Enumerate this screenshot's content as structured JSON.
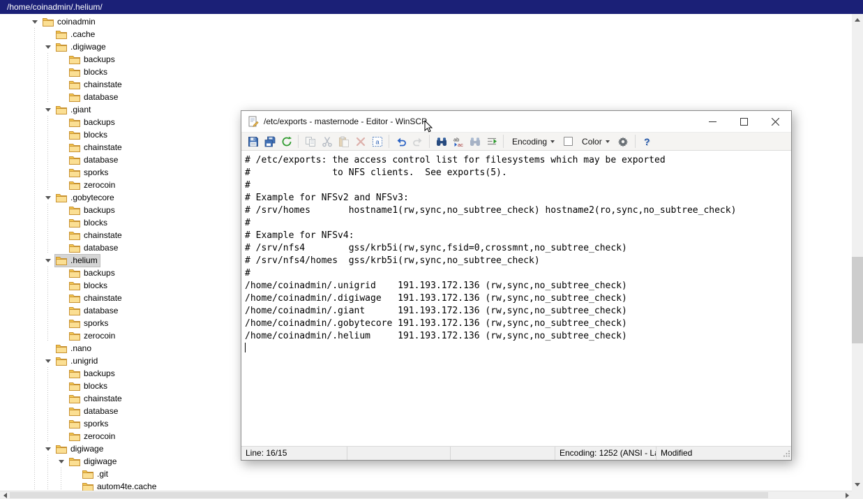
{
  "app": {
    "path": "/home/coinadmin/.helium/"
  },
  "tree": {
    "items": [
      {
        "label": "coinadmin",
        "level": 0,
        "expanded": true
      },
      {
        "label": ".cache",
        "level": 1
      },
      {
        "label": ".digiwage",
        "level": 1,
        "expanded": true
      },
      {
        "label": "backups",
        "level": 2
      },
      {
        "label": "blocks",
        "level": 2
      },
      {
        "label": "chainstate",
        "level": 2
      },
      {
        "label": "database",
        "level": 2
      },
      {
        "label": ".giant",
        "level": 1,
        "expanded": true
      },
      {
        "label": "backups",
        "level": 2
      },
      {
        "label": "blocks",
        "level": 2
      },
      {
        "label": "chainstate",
        "level": 2
      },
      {
        "label": "database",
        "level": 2
      },
      {
        "label": "sporks",
        "level": 2
      },
      {
        "label": "zerocoin",
        "level": 2
      },
      {
        "label": ".gobytecore",
        "level": 1,
        "expanded": true
      },
      {
        "label": "backups",
        "level": 2
      },
      {
        "label": "blocks",
        "level": 2
      },
      {
        "label": "chainstate",
        "level": 2
      },
      {
        "label": "database",
        "level": 2
      },
      {
        "label": ".helium",
        "level": 1,
        "expanded": true,
        "selected": true
      },
      {
        "label": "backups",
        "level": 2
      },
      {
        "label": "blocks",
        "level": 2
      },
      {
        "label": "chainstate",
        "level": 2
      },
      {
        "label": "database",
        "level": 2
      },
      {
        "label": "sporks",
        "level": 2
      },
      {
        "label": "zerocoin",
        "level": 2
      },
      {
        "label": ".nano",
        "level": 1
      },
      {
        "label": ".unigrid",
        "level": 1,
        "expanded": true
      },
      {
        "label": "backups",
        "level": 2
      },
      {
        "label": "blocks",
        "level": 2
      },
      {
        "label": "chainstate",
        "level": 2
      },
      {
        "label": "database",
        "level": 2
      },
      {
        "label": "sporks",
        "level": 2
      },
      {
        "label": "zerocoin",
        "level": 2
      },
      {
        "label": "digiwage",
        "level": 1,
        "expanded": true
      },
      {
        "label": "digiwage",
        "level": 2,
        "expanded": true
      },
      {
        "label": ".git",
        "level": 3
      },
      {
        "label": "autom4te.cache",
        "level": 3
      }
    ]
  },
  "editor": {
    "title": "/etc/exports - masternode - Editor - WinSCP",
    "toolbar": {
      "buttons": [
        {
          "name": "save",
          "enabled": true
        },
        {
          "name": "save-all",
          "enabled": true
        },
        {
          "name": "reload",
          "enabled": true
        },
        {
          "type": "separator"
        },
        {
          "name": "copy",
          "enabled": false
        },
        {
          "name": "cut",
          "enabled": false
        },
        {
          "name": "paste",
          "enabled": false
        },
        {
          "name": "delete",
          "enabled": false
        },
        {
          "name": "select-all",
          "enabled": true
        },
        {
          "type": "separator"
        },
        {
          "name": "undo",
          "enabled": true
        },
        {
          "name": "redo",
          "enabled": false
        },
        {
          "type": "separator"
        },
        {
          "name": "find",
          "enabled": true
        },
        {
          "name": "replace",
          "enabled": true
        },
        {
          "name": "find-next",
          "enabled": false
        },
        {
          "name": "go-to-line",
          "enabled": true
        },
        {
          "type": "separator"
        },
        {
          "name": "encoding",
          "label": "Encoding",
          "dropdown": true,
          "enabled": true
        },
        {
          "name": "color-checkbox",
          "checkbox": true,
          "checked": false,
          "enabled": true
        },
        {
          "name": "color",
          "label": "Color",
          "dropdown": true,
          "enabled": true
        },
        {
          "name": "preferences",
          "enabled": true
        },
        {
          "type": "separator"
        },
        {
          "name": "help",
          "enabled": true
        }
      ]
    },
    "lines": [
      "# /etc/exports: the access control list for filesystems which may be exported",
      "#               to NFS clients.  See exports(5).",
      "#",
      "# Example for NFSv2 and NFSv3:",
      "# /srv/homes       hostname1(rw,sync,no_subtree_check) hostname2(ro,sync,no_subtree_check)",
      "#",
      "# Example for NFSv4:",
      "# /srv/nfs4        gss/krb5i(rw,sync,fsid=0,crossmnt,no_subtree_check)",
      "# /srv/nfs4/homes  gss/krb5i(rw,sync,no_subtree_check)",
      "#",
      "/home/coinadmin/.unigrid    191.193.172.136 (rw,sync,no_subtree_check)",
      "/home/coinadmin/.digiwage   191.193.172.136 (rw,sync,no_subtree_check)",
      "/home/coinadmin/.giant      191.193.172.136 (rw,sync,no_subtree_check)",
      "/home/coinadmin/.gobytecore 191.193.172.136 (rw,sync,no_subtree_check)",
      "/home/coinadmin/.helium     191.193.172.136 (rw,sync,no_subtree_check)",
      ""
    ],
    "status": {
      "line": "Line: 16/15",
      "encoding": "Encoding: 1252 (ANSI - La",
      "modified": "Modified"
    }
  }
}
